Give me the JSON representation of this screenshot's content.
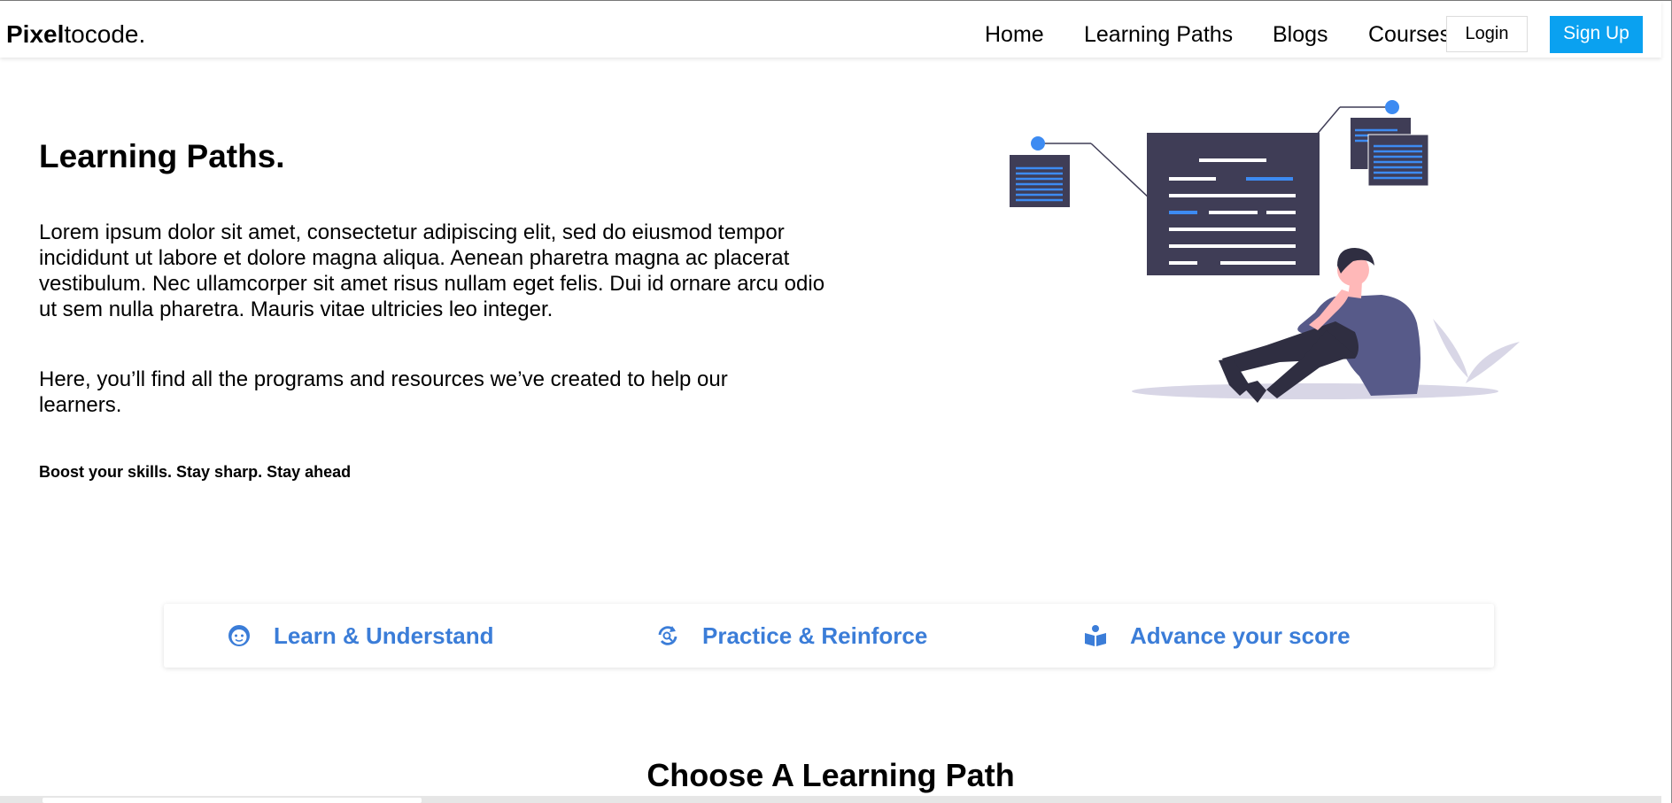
{
  "brand": {
    "name_bold": "Pixel",
    "name_rest": "tocode."
  },
  "nav": {
    "links": [
      "Home",
      "Learning Paths",
      "Blogs",
      "Courses"
    ],
    "login_label": "Login",
    "signup_label": "Sign Up"
  },
  "hero": {
    "title": "Learning Paths.",
    "paragraph1": "Lorem ipsum dolor sit amet, consectetur adipiscing elit, sed do eiusmod tempor incididunt ut labore et dolore magna aliqua. Aenean pharetra magna ac placerat vestibulum. Nec ullamcorper sit amet risus nullam eget felis. Dui id ornare arcu odio ut sem nulla pharetra. Mauris vitae ultricies leo integer.",
    "paragraph2": "Here, you’ll find all the programs and resources we’ve created to help our learners.",
    "tagline": "Boost your skills. Stay sharp. Stay ahead"
  },
  "features": [
    {
      "label": "Learn & Understand",
      "icon": "smile-face-icon"
    },
    {
      "label": "Practice & Reinforce",
      "icon": "refresh-search-icon"
    },
    {
      "label": "Advance your score",
      "icon": "book-reader-icon"
    }
  ],
  "section": {
    "title": "Choose A Learning Path"
  },
  "colors": {
    "accent_blue": "#3b7dd8",
    "signup_blue": "#0aa1f0",
    "illustration_dark": "#3f3d56",
    "illustration_blue": "#3d8bf2",
    "illustration_purple": "#575a89"
  }
}
